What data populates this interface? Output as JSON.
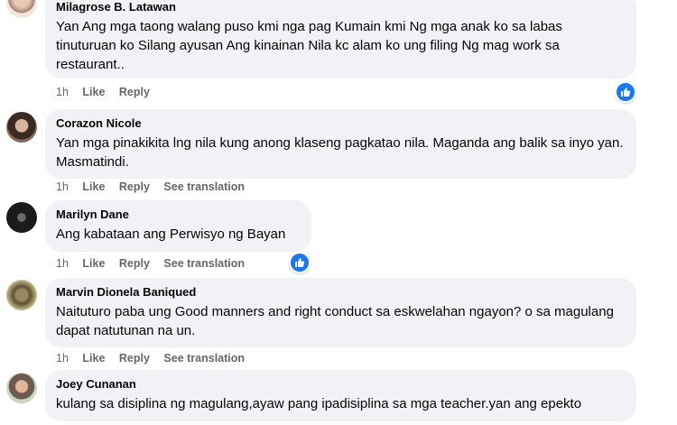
{
  "comments": [
    {
      "author": "Milagrose B. Latawan",
      "text": "Yan Ang mga taong walang puso kmi nga pag Kumain kmi Ng mga anak ko sa labas tinuturuan ko Silang ayusan Ang kinainan Nila kc alam ko ung filing Ng mag work sa restaurant..",
      "time": "1h",
      "like": "Like",
      "reply": "Reply",
      "translate": ""
    },
    {
      "author": "Corazon Nicole",
      "text": "Yan mga pinakikita lng nila kung anong klaseng pagkatao nila. Maganda ang balik sa inyo yan. Masmatindi.",
      "time": "1h",
      "like": "Like",
      "reply": "Reply",
      "translate": "See translation"
    },
    {
      "author": "Marilyn Dane",
      "text": "Ang kabataan ang Perwisyo ng Bayan",
      "time": "1h",
      "like": "Like",
      "reply": "Reply",
      "translate": "See translation"
    },
    {
      "author": "Marvin Dionela Baniqued",
      "text": "Naituturo paba ung Good manners and right conduct sa eskwelahan ngayon? o sa magulang dapat natutunan na un.",
      "time": "1h",
      "like": "Like",
      "reply": "Reply",
      "translate": "See translation"
    },
    {
      "author": "Joey Cunanan",
      "text": "kulang sa disiplina ng magulang,ayaw pang ipadisiplina sa mga teacher.yan ang epekto",
      "time": "",
      "like": "",
      "reply": "",
      "translate": ""
    }
  ],
  "icons": {
    "reaction": "like-reaction-icon",
    "avatar": "avatar"
  },
  "colors": {
    "bubble": "#f0f2f5",
    "meta": "#65676b",
    "like_blue": "#1877f2"
  }
}
